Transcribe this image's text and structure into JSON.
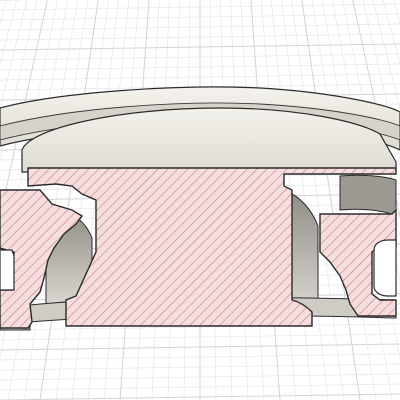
{
  "viewport": {
    "view": "section-analysis",
    "background_color": "#ffffff",
    "grid": {
      "shown": true,
      "minor_color": "#e3e6ea",
      "major_color": "#cfd4da"
    }
  },
  "model": {
    "body_top_color": "#e7e4dd",
    "body_side_color": "#bfbcb5",
    "cut_face_fill_color": "#f6dede",
    "hatch_color": "#c0747e",
    "edge_color": "#2b2b2b"
  }
}
